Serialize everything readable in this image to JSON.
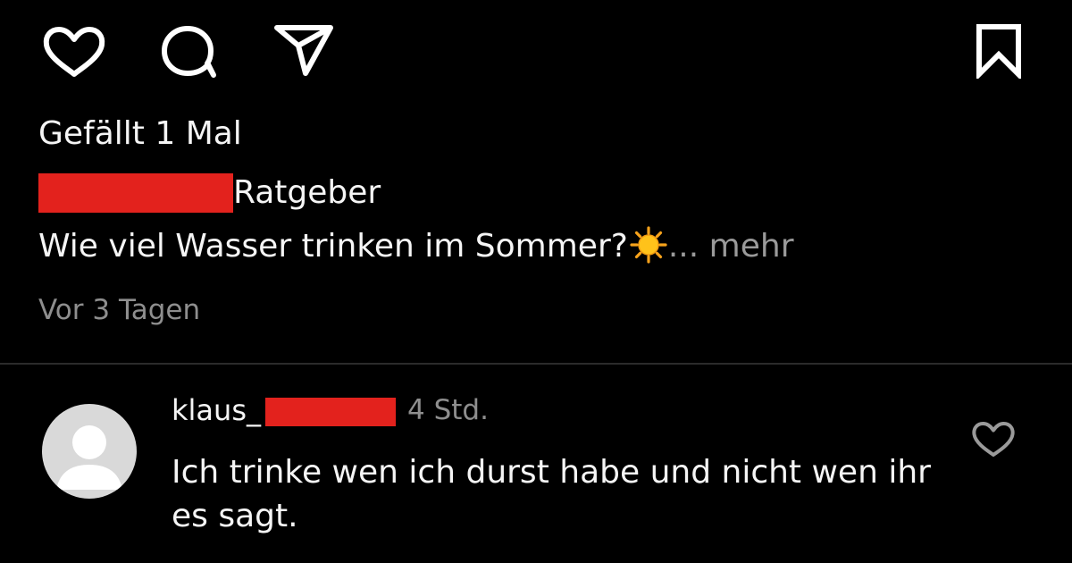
{
  "post": {
    "actions": {
      "like_icon": "heart-icon",
      "comment_icon": "comment-bubble-icon",
      "share_icon": "send-paper-plane-icon",
      "save_icon": "bookmark-icon"
    },
    "likes_text": "Gefällt 1 Mal",
    "caption": {
      "line1_rest": "Ratgeber",
      "line2_text": "Wie viel Wasser trinken im Sommer?",
      "line2_emoji": "sun-emoji",
      "ellipsis": "...",
      "more_label": "mehr"
    },
    "timestamp": "Vor 3 Tagen"
  },
  "comment": {
    "username_visible": "klaus_",
    "time": "4 Std.",
    "text": "Ich trinke wen ich durst habe und nicht wen ihr es sagt.",
    "like_icon": "heart-outline-icon"
  },
  "colors": {
    "background": "#000000",
    "text": "#f5f5f5",
    "muted_text": "#8e8e8e",
    "redaction": "#e3221d",
    "avatar_bg": "#d9d9d9"
  }
}
